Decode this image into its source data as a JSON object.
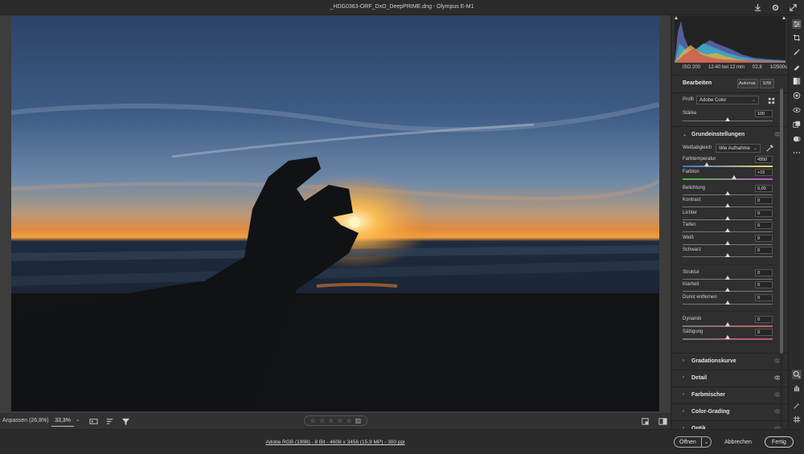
{
  "window": {
    "title": "_HDG0363-ORF_DxO_DeepPRIME.dng  -  Olympus E-M1"
  },
  "exif": {
    "iso": "ISO 200",
    "lens": "12-40 bei 12 mm",
    "aperture": "f/2,8",
    "shutter": "1/2500s"
  },
  "edit": {
    "title": "Bearbeiten",
    "auto_label": "Automat.",
    "bw_label": "S/W",
    "profile_label": "Profil",
    "profile_value": "Adobe Color",
    "amount_label": "Stärke",
    "amount_value": "100",
    "amount_fraction": 0.5
  },
  "basic": {
    "title": "Grundeinstellungen",
    "wb_label": "Weißabgleich",
    "wb_value": "Wie Aufnahme",
    "sliders": [
      {
        "label": "Farbtemperatur",
        "value": "4950",
        "pos": 0.27
      },
      {
        "label": "Farbton",
        "value": "+15",
        "pos": 0.57
      },
      {
        "label": "Belichtung",
        "value": "0,00",
        "pos": 0.5
      },
      {
        "label": "Kontrast",
        "value": "0",
        "pos": 0.5
      },
      {
        "label": "Lichter",
        "value": "0",
        "pos": 0.5
      },
      {
        "label": "Tiefen",
        "value": "0",
        "pos": 0.5
      },
      {
        "label": "Weiß",
        "value": "0",
        "pos": 0.5
      },
      {
        "label": "Schwarz",
        "value": "0",
        "pos": 0.5
      },
      {
        "label": "Struktur",
        "value": "0",
        "pos": 0.5
      },
      {
        "label": "Klarheit",
        "value": "0",
        "pos": 0.5
      },
      {
        "label": "Dunst entfernen",
        "value": "0",
        "pos": 0.5
      },
      {
        "label": "Dynamik",
        "value": "0",
        "pos": 0.5
      },
      {
        "label": "Sättigung",
        "value": "0",
        "pos": 0.5
      }
    ]
  },
  "sections": [
    {
      "name": "Gradationskurve"
    },
    {
      "name": "Detail"
    },
    {
      "name": "Farbmischer"
    },
    {
      "name": "Color-Grading"
    },
    {
      "name": "Optik"
    }
  ],
  "imgbar": {
    "fit_label": "Anpassen (26,8%)",
    "zoom_value": "33,3%"
  },
  "footer": {
    "info": "Adobe RGB (1998) - 8 Bit - 4608 x 3456 (15,9 MP) - 300 ppi",
    "open": "Öffnen",
    "cancel": "Abbrechen",
    "done": "Fertig"
  },
  "colors": {
    "panel_bg": "#2f2f2f",
    "sunset_orange": "#f08a2a",
    "sky_blue": "#4f6f98"
  },
  "icons": {
    "rail": [
      "edit-sliders-icon",
      "crop-icon",
      "healing-icon",
      "brush-icon",
      "gradient-icon",
      "radial-icon",
      "redeye-icon",
      "snapshots-icon",
      "presets-icon",
      "more-icon"
    ],
    "rail_bottom": [
      "zoom-icon",
      "hand-icon",
      "color-sampler-icon",
      "grid-icon"
    ]
  }
}
